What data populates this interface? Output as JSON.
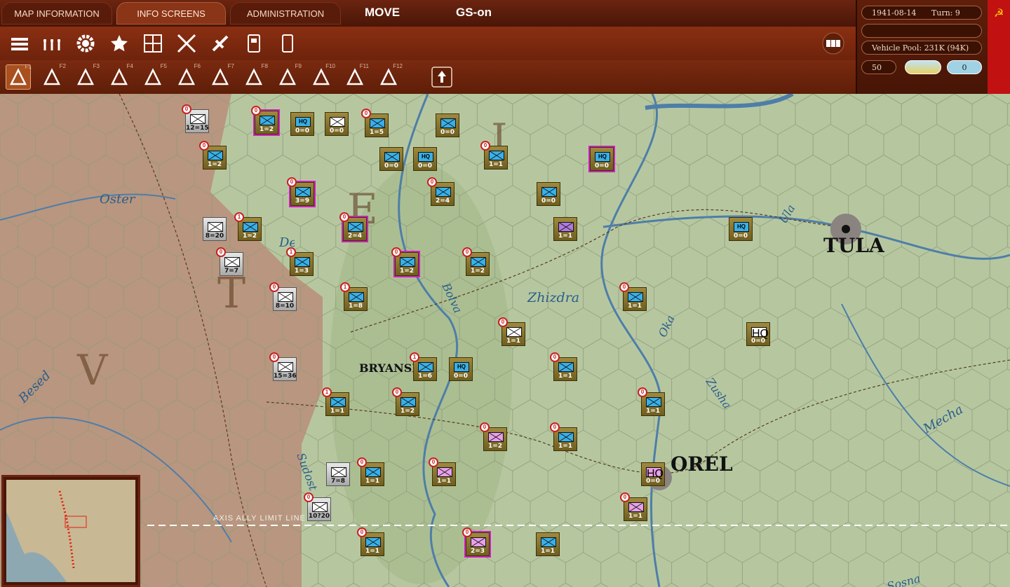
{
  "tabs": [
    {
      "label": "MAP INFORMATION",
      "active": false
    },
    {
      "label": "INFO SCREENS",
      "active": true
    },
    {
      "label": "ADMINISTRATION",
      "active": false
    }
  ],
  "mode_label": "MOVE",
  "gs_label": "GS-on",
  "status": {
    "date": "1941-08-14",
    "turn": "Turn: 9",
    "vehicle_pool": "Vehicle Pool: 231K (94K)",
    "value_box": "50",
    "counter_box": "0"
  },
  "toolbar_top_icons": [
    "unit-stack-icon",
    "ground-units-icon",
    "settings-gear-icon",
    "star-icon",
    "city-grid-icon",
    "air-missions-icon",
    "aircraft-icon",
    "supply-depot-icon",
    "phone-icon"
  ],
  "toolbar_right_icons": [
    "reports-icon"
  ],
  "toolbar_mode_icons": [
    {
      "icon": "move-icon",
      "fkey": "F1"
    },
    {
      "icon": "rail-icon",
      "fkey": "F2"
    },
    {
      "icon": "naval-icon",
      "fkey": "F3"
    },
    {
      "icon": "shore-icon",
      "fkey": "F4"
    },
    {
      "icon": "air-recon-icon",
      "fkey": "F5"
    },
    {
      "icon": "artillery-icon",
      "fkey": "F6"
    },
    {
      "icon": "airstrike-icon",
      "fkey": "F7"
    },
    {
      "icon": "bombard-icon",
      "fkey": "F8"
    },
    {
      "icon": "paradrop-icon",
      "fkey": "F9"
    },
    {
      "icon": "air-transport-icon",
      "fkey": "F10"
    },
    {
      "icon": "explosion-icon",
      "fkey": "F11"
    },
    {
      "icon": "next-unit-icon",
      "fkey": "F12"
    }
  ],
  "map": {
    "places": [
      "TULA",
      "OREL",
      "BRYANSK"
    ],
    "rivers": [
      "Oster",
      "Ula",
      "Zhizdra",
      "Bolva",
      "Oka",
      "Zusha",
      "Mecha",
      "Desna",
      "Besed",
      "Sudost",
      "Sosna"
    ],
    "fronts": [
      "E",
      "V",
      "T",
      "I"
    ],
    "axis_ally_limit": "AXIS ALLY LIMIT LINE",
    "units": [
      {
        "str": "12=15",
        "badge": "0",
        "kind": "axis",
        "sym": "white"
      },
      {
        "str": "1=2",
        "badge": "0",
        "kind": "sov",
        "sym": "blue",
        "sel": true
      },
      {
        "str": "0=0",
        "badge": "",
        "kind": "sov",
        "sym": "hq",
        "hq": "HQ"
      },
      {
        "str": "0=0",
        "badge": "",
        "kind": "sov",
        "sym": "white"
      },
      {
        "str": "1=5",
        "badge": "0",
        "kind": "sov",
        "sym": "blue"
      },
      {
        "str": "0=0",
        "badge": "",
        "kind": "sov",
        "sym": "blue"
      },
      {
        "str": "1=2",
        "badge": "0",
        "kind": "sov",
        "sym": "blue"
      },
      {
        "str": "0=0",
        "badge": "",
        "kind": "sov",
        "sym": "blue"
      },
      {
        "str": "0=0",
        "badge": "",
        "kind": "sov",
        "sym": "hq",
        "hq": "HQ"
      },
      {
        "str": "1=1",
        "badge": "0",
        "kind": "sov",
        "sym": "blue"
      },
      {
        "str": "0=0",
        "badge": "",
        "kind": "sov",
        "sym": "hq",
        "hq": "HQ",
        "sel": true
      },
      {
        "str": "3=9",
        "badge": "0",
        "kind": "sov",
        "sym": "blue",
        "sel": true
      },
      {
        "str": "2=4",
        "badge": "0",
        "kind": "sov",
        "sym": "blue"
      },
      {
        "str": "0=0",
        "badge": "",
        "kind": "sov",
        "sym": "blue"
      },
      {
        "str": "8=20",
        "badge": "",
        "kind": "axis",
        "sym": "white"
      },
      {
        "str": "1=2",
        "badge": "1",
        "kind": "sov",
        "sym": "blue"
      },
      {
        "str": "2=4",
        "badge": "0",
        "kind": "sov",
        "sym": "blue",
        "sel": true
      },
      {
        "str": "1=1",
        "badge": "",
        "kind": "sov",
        "sym": "purple"
      },
      {
        "str": "0=0",
        "badge": "",
        "kind": "sov",
        "sym": "hq",
        "hq": "HQ"
      },
      {
        "str": "7=7",
        "badge": "0",
        "kind": "axis",
        "sym": "white"
      },
      {
        "str": "1=3",
        "badge": "1",
        "kind": "sov",
        "sym": "blue"
      },
      {
        "str": "1=2",
        "badge": "0",
        "kind": "sov",
        "sym": "blue",
        "sel": true
      },
      {
        "str": "1=2",
        "badge": "0",
        "kind": "sov",
        "sym": "blue"
      },
      {
        "str": "8=10",
        "badge": "0",
        "kind": "axis",
        "sym": "white"
      },
      {
        "str": "1=8",
        "badge": "1",
        "kind": "sov",
        "sym": "blue"
      },
      {
        "str": "1=1",
        "badge": "0",
        "kind": "sov",
        "sym": "blue"
      },
      {
        "str": "1=1",
        "badge": "0",
        "kind": "sov",
        "sym": "white"
      },
      {
        "str": "0=0",
        "badge": "",
        "kind": "sov",
        "sym": "white",
        "hq": "HQ"
      },
      {
        "str": "15=36",
        "badge": "0",
        "kind": "axis",
        "sym": "white"
      },
      {
        "str": "1=6",
        "badge": "1",
        "kind": "sov",
        "sym": "blue"
      },
      {
        "str": "0=0",
        "badge": "",
        "kind": "sov",
        "sym": "hq",
        "hq": "HQ"
      },
      {
        "str": "1=1",
        "badge": "0",
        "kind": "sov",
        "sym": "blue"
      },
      {
        "str": "1=1",
        "badge": "1",
        "kind": "sov",
        "sym": "blue"
      },
      {
        "str": "1=2",
        "badge": "0",
        "kind": "sov",
        "sym": "blue"
      },
      {
        "str": "1=1",
        "badge": "0",
        "kind": "sov",
        "sym": "blue"
      },
      {
        "str": "1=2",
        "badge": "0",
        "kind": "sov",
        "sym": "pink"
      },
      {
        "str": "1=1",
        "badge": "0",
        "kind": "sov",
        "sym": "blue"
      },
      {
        "str": "7=8",
        "badge": "",
        "kind": "axis",
        "sym": "white"
      },
      {
        "str": "1=1",
        "badge": "0",
        "kind": "sov",
        "sym": "blue"
      },
      {
        "str": "1=1",
        "badge": "0",
        "kind": "sov",
        "sym": "pink"
      },
      {
        "str": "0=0",
        "badge": "",
        "kind": "sov",
        "sym": "pink",
        "hq": "HQ"
      },
      {
        "str": "10?20",
        "badge": "0",
        "kind": "axis",
        "sym": "white"
      },
      {
        "str": "1=1",
        "badge": "0",
        "kind": "sov",
        "sym": "blue"
      },
      {
        "str": "1=1",
        "badge": "",
        "kind": "sov",
        "sym": "blue"
      },
      {
        "str": "2=3",
        "badge": "0",
        "kind": "sov",
        "sym": "pink",
        "sel": true
      },
      {
        "str": "1=1",
        "badge": "0",
        "kind": "sov",
        "sym": "pink"
      }
    ]
  }
}
